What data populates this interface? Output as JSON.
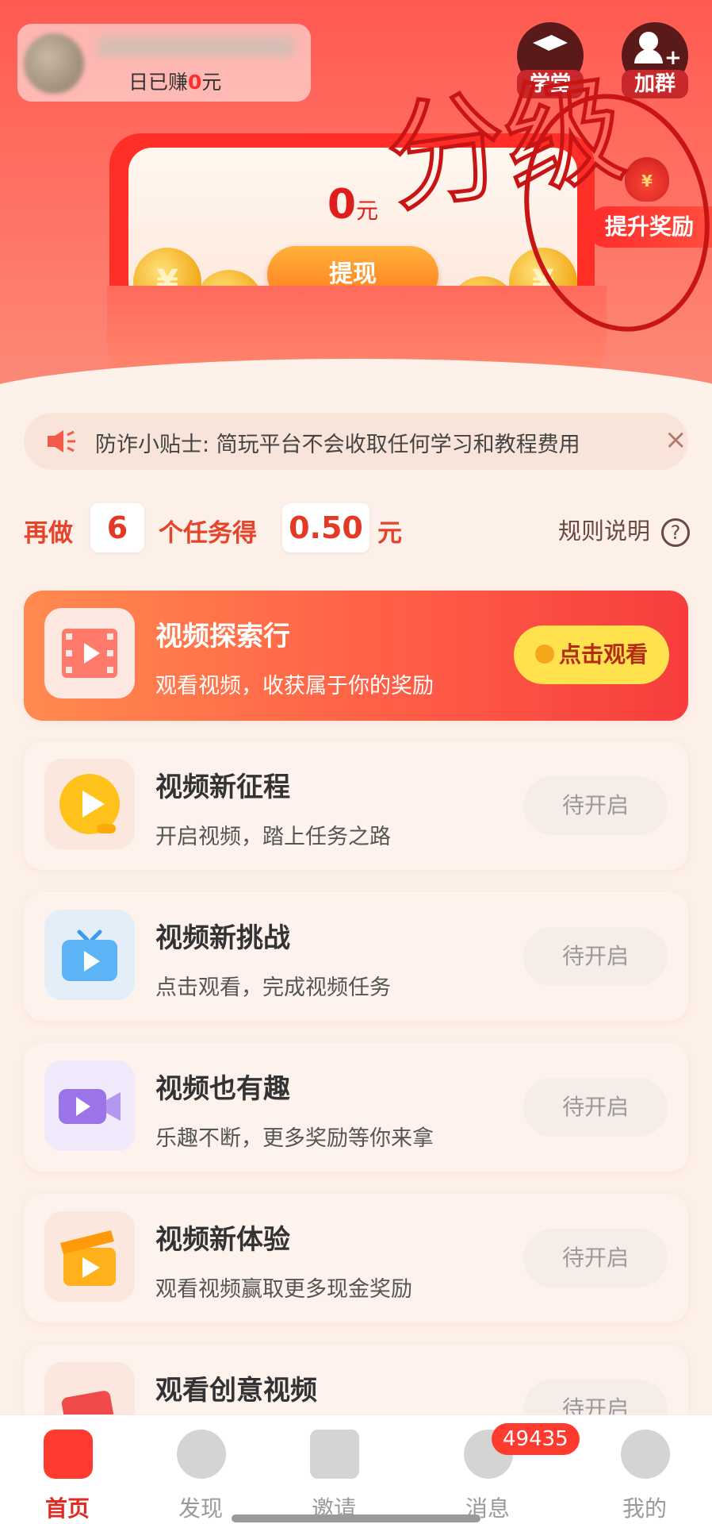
{
  "header": {
    "earned_prefix": "日已赚",
    "earned_amount": "0",
    "earned_unit": "元",
    "school_label": "学堂",
    "group_label": "加群"
  },
  "wallet": {
    "balance": "0",
    "unit": "元",
    "withdraw_label": "提现",
    "boost_label": "提升奖励"
  },
  "annotation": {
    "scribble_text": "分级"
  },
  "notice": {
    "text": "防诈小贴士: 简玩平台不会收取任何学习和教程费用",
    "close": "×"
  },
  "progress": {
    "prefix": "再做",
    "count": "6",
    "middle": "个任务得",
    "reward": "0.50",
    "unit": "元",
    "rules_label": "规则说明",
    "help": "?"
  },
  "tasks": [
    {
      "title": "视频探索行",
      "desc": "观看视频，收获属于你的奖励",
      "action": "点击观看",
      "icon": "film-play-icon",
      "active": true
    },
    {
      "title": "视频新征程",
      "desc": "开启视频，踏上任务之路",
      "action": "待开启",
      "icon": "play-circle-icon"
    },
    {
      "title": "视频新挑战",
      "desc": "点击观看，完成视频任务",
      "action": "待开启",
      "icon": "tv-icon"
    },
    {
      "title": "视频也有趣",
      "desc": "乐趣不断，更多奖励等你来拿",
      "action": "待开启",
      "icon": "video-camera-icon"
    },
    {
      "title": "视频新体验",
      "desc": "观看视频赢取更多现金奖励",
      "action": "待开启",
      "icon": "clapperboard-icon"
    },
    {
      "title": "观看创意视频",
      "desc": "",
      "action": "待开启",
      "icon": "creative-video-icon"
    }
  ],
  "tabbar": {
    "items": [
      {
        "label": "首页",
        "icon": "home-icon"
      },
      {
        "label": "发现",
        "icon": "compass-icon"
      },
      {
        "label": "邀请",
        "icon": "invite-icon"
      },
      {
        "label": "消息",
        "icon": "message-icon"
      },
      {
        "label": "我的",
        "icon": "profile-icon"
      }
    ],
    "message_badge": "49435"
  },
  "colors": {
    "brand_red": "#ff3a2f",
    "accent_yellow": "#ffe24d",
    "text_red": "#e23a25",
    "page_bg": "#fdf0e8"
  }
}
